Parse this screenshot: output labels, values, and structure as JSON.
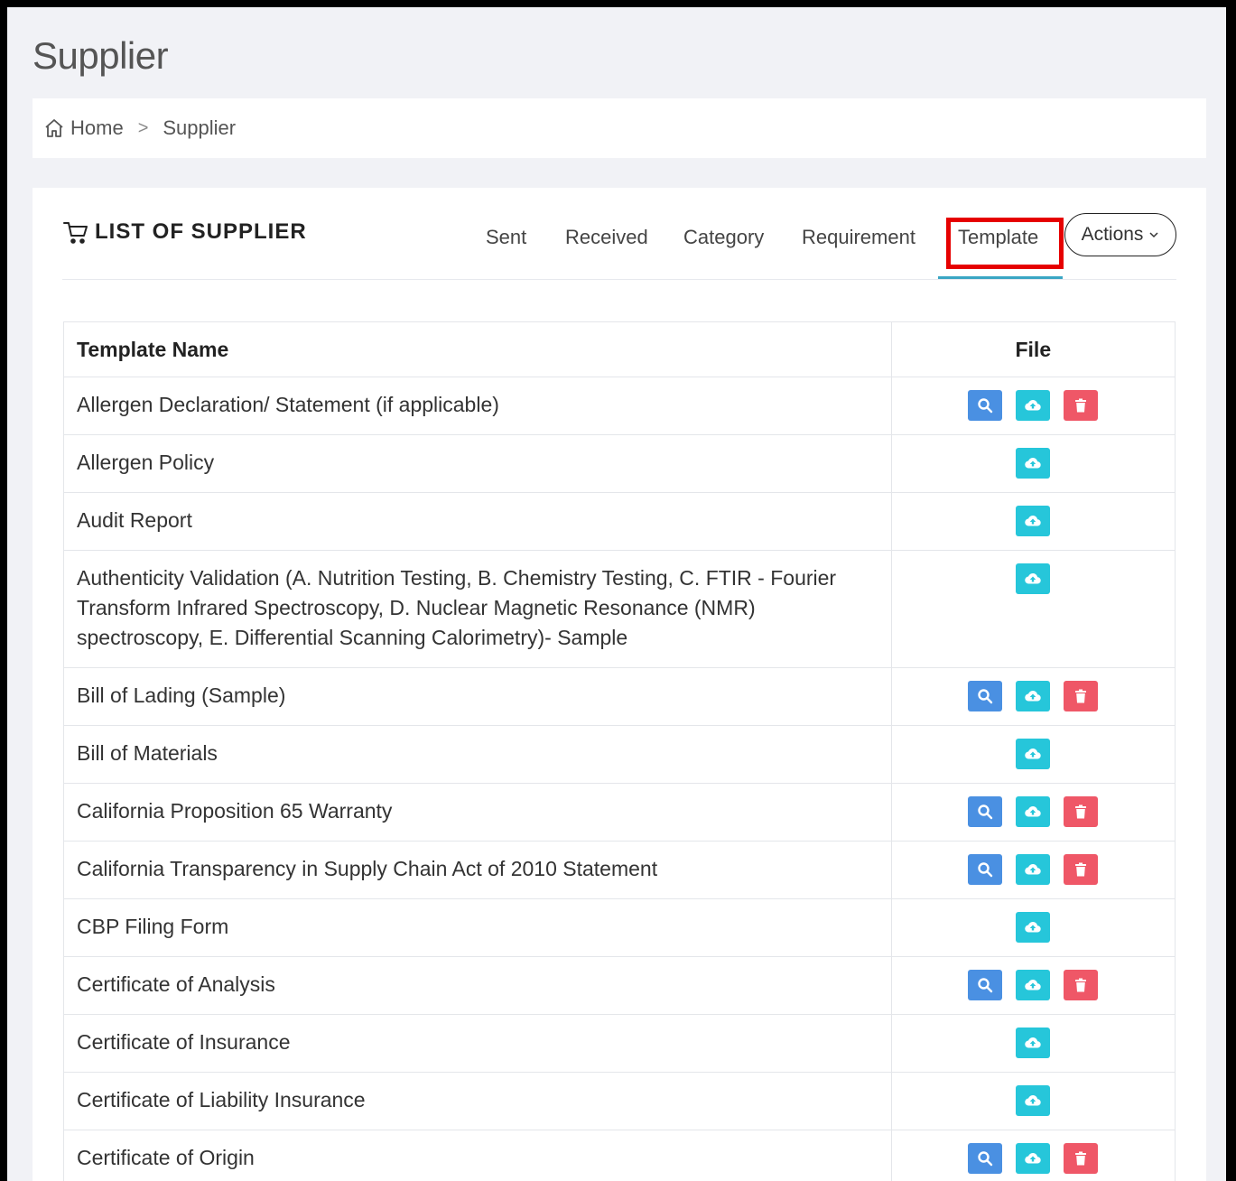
{
  "page": {
    "title": "Supplier"
  },
  "breadcrumb": {
    "home": "Home",
    "separator": ">",
    "current": "Supplier"
  },
  "card": {
    "title": "LIST OF SUPPLIER",
    "tabs": [
      {
        "label": "Sent"
      },
      {
        "label": "Received"
      },
      {
        "label": "Category"
      },
      {
        "label": "Requirement"
      },
      {
        "label": "Template",
        "active": true
      }
    ],
    "actions_label": "Actions"
  },
  "table": {
    "headers": {
      "name": "Template Name",
      "file": "File"
    },
    "rows": [
      {
        "name": "Allergen Declaration/ Statement (if applicable)",
        "buttons": [
          "view",
          "upload",
          "delete"
        ]
      },
      {
        "name": "Allergen Policy",
        "buttons": [
          "upload"
        ]
      },
      {
        "name": "Audit Report",
        "buttons": [
          "upload"
        ]
      },
      {
        "name": "Authenticity Validation (A. Nutrition Testing, B. Chemistry Testing, C. FTIR - Fourier Transform Infrared Spectroscopy, D. Nuclear Magnetic Resonance (NMR) spectroscopy, E. Differential Scanning Calorimetry)- Sample",
        "buttons": [
          "upload"
        ]
      },
      {
        "name": "Bill of Lading (Sample)",
        "buttons": [
          "view",
          "upload",
          "delete"
        ]
      },
      {
        "name": "Bill of Materials",
        "buttons": [
          "upload"
        ]
      },
      {
        "name": "California Proposition 65 Warranty",
        "buttons": [
          "view",
          "upload",
          "delete"
        ]
      },
      {
        "name": "California Transparency in Supply Chain Act of 2010 Statement",
        "buttons": [
          "view",
          "upload",
          "delete"
        ]
      },
      {
        "name": "CBP Filing Form",
        "buttons": [
          "upload"
        ]
      },
      {
        "name": "Certificate of Analysis",
        "buttons": [
          "view",
          "upload",
          "delete"
        ]
      },
      {
        "name": "Certificate of Insurance",
        "buttons": [
          "upload"
        ]
      },
      {
        "name": "Certificate of Liability Insurance",
        "buttons": [
          "upload"
        ]
      },
      {
        "name": "Certificate of Origin",
        "buttons": [
          "view",
          "upload",
          "delete"
        ]
      }
    ]
  },
  "icons": {
    "view": "search-icon",
    "upload": "cloud-upload-icon",
    "delete": "trash-icon"
  },
  "colors": {
    "view_button": "#4a90e2",
    "upload_button": "#26c6da",
    "delete_button": "#ef5767",
    "highlight": "#e60000",
    "active_tab_underline": "#3aa6c4"
  }
}
